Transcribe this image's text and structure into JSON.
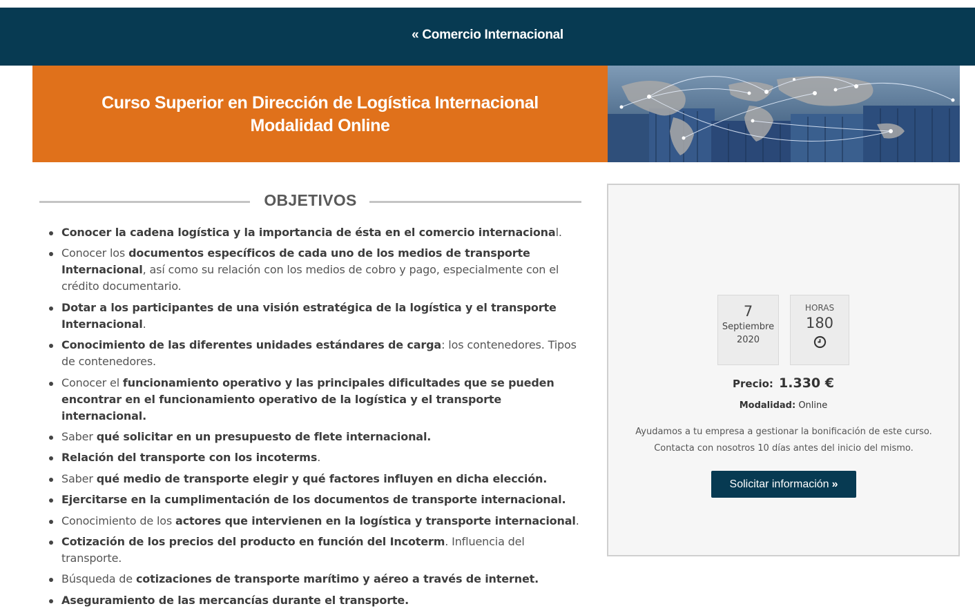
{
  "nav": {
    "back_link": "« Comercio Internacional"
  },
  "hero": {
    "title_line1": "Curso Superior en Dirección de Logística Internacional",
    "title_line2": "Modalidad Online",
    "image": "world-network-containers-image"
  },
  "objectives": {
    "heading": "OBJETIVOS",
    "items": [
      [
        {
          "t": "Conocer la cadena logística y la importancia de ésta en el comercio internaciona",
          "b": true
        },
        {
          "t": "l.",
          "b": false
        }
      ],
      [
        {
          "t": "Conocer los ",
          "b": false
        },
        {
          "t": "documentos específicos de cada uno de los medios de transporte Internacional",
          "b": true
        },
        {
          "t": ", así como su relación con los medios de cobro y pago, especialmente con el crédito documentario.",
          "b": false
        }
      ],
      [
        {
          "t": "Dotar a los participantes de una visión estratégica de la logística y el transporte Internacional",
          "b": true
        },
        {
          "t": ".",
          "b": false
        }
      ],
      [
        {
          "t": "Conocimiento de las diferentes unidades estándares de carga",
          "b": true
        },
        {
          "t": ": los contenedores. Tipos de contenedores.",
          "b": false
        }
      ],
      [
        {
          "t": "Conocer el ",
          "b": false
        },
        {
          "t": "funcionamiento operativo y las principales dificultades que se pueden encontrar en el funcionamiento operativo de la logística y el transporte internacional.",
          "b": true
        }
      ],
      [
        {
          "t": "Saber ",
          "b": false
        },
        {
          "t": "qué solicitar en un presupuesto de flete internacional.",
          "b": true
        }
      ],
      [
        {
          "t": "Relación del transporte con los incoterms",
          "b": true
        },
        {
          "t": ".",
          "b": false
        }
      ],
      [
        {
          "t": "Saber ",
          "b": false
        },
        {
          "t": "qué medio de transporte elegir y qué factores influyen en dicha elección.",
          "b": true
        }
      ],
      [
        {
          "t": "Ejercitarse en la cumplimentación de los documentos de transporte internacional.",
          "b": true
        }
      ],
      [
        {
          "t": "Conocimiento de los ",
          "b": false
        },
        {
          "t": "actores que intervienen en la logística y transporte internacional",
          "b": true
        },
        {
          "t": ".",
          "b": false
        }
      ],
      [
        {
          "t": "Cotización de los precios del producto en función del Incoterm",
          "b": true
        },
        {
          "t": ". Influencia del transporte.",
          "b": false
        }
      ],
      [
        {
          "t": "Búsqueda de ",
          "b": false
        },
        {
          "t": "cotizaciones de transporte marítimo y aéreo a través de internet.",
          "b": true
        }
      ],
      [
        {
          "t": "Aseguramiento de las mercancías durante el transporte.",
          "b": true
        }
      ]
    ]
  },
  "sidebar": {
    "date": {
      "day": "7",
      "month": "Septiembre",
      "year": "2020"
    },
    "hours": {
      "label": "HORAS",
      "value": "180",
      "icon": "clock-icon"
    },
    "price": {
      "label": "Precio:",
      "value": "1.330 €"
    },
    "mode": {
      "label": "Modalidad:",
      "value": "Online"
    },
    "note": "Ayudamos a tu empresa a gestionar la bonificación de este curso. Contacta con nosotros 10 días antes del inicio del mismo.",
    "cta": {
      "label": "Solicitar información",
      "icon": "double-chevron-right-icon"
    }
  },
  "colors": {
    "navy": "#073a52",
    "orange": "#e0711b",
    "panel": "#f6f6f6"
  }
}
